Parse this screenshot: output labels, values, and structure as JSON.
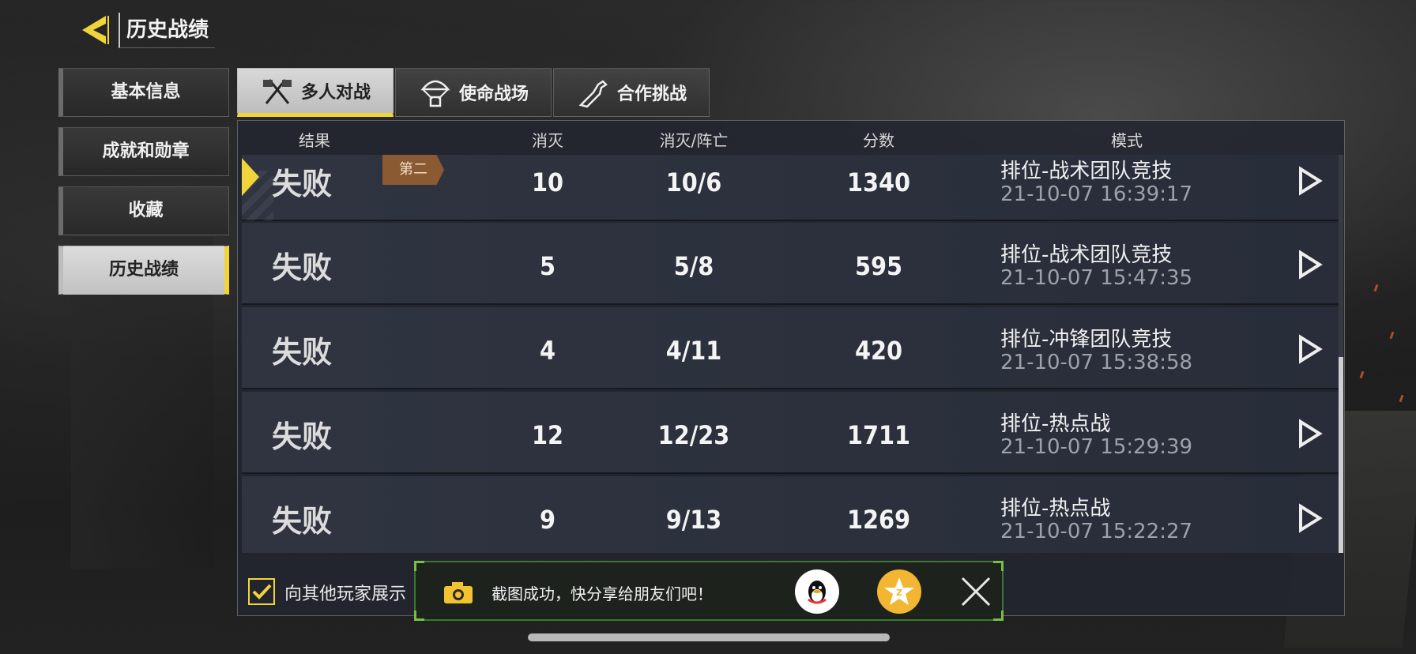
{
  "header": {
    "title": "历史战绩"
  },
  "sidebar": {
    "items": [
      {
        "label": "基本信息",
        "active": false
      },
      {
        "label": "成就和勋章",
        "active": false
      },
      {
        "label": "收藏",
        "active": false
      },
      {
        "label": "历史战绩",
        "active": true
      }
    ]
  },
  "tabs": [
    {
      "label": "多人对战",
      "icon": "crossed-flags-icon",
      "active": true
    },
    {
      "label": "使命战场",
      "icon": "parachute-crate-icon",
      "active": false
    },
    {
      "label": "合作挑战",
      "icon": "zombie-arm-icon",
      "active": false
    }
  ],
  "table": {
    "columns": [
      "结果",
      "消灭",
      "消灭/阵亡",
      "分数",
      "模式"
    ],
    "rows": [
      {
        "result": "失败",
        "kills": "10",
        "kd": "10/6",
        "score": "1340",
        "mode": "排位-战术团队竞技",
        "time": "21-10-07 16:39:17",
        "badge": "第二",
        "selected": true
      },
      {
        "result": "失败",
        "kills": "5",
        "kd": "5/8",
        "score": "595",
        "mode": "排位-战术团队竞技",
        "time": "21-10-07 15:47:35"
      },
      {
        "result": "失败",
        "kills": "4",
        "kd": "4/11",
        "score": "420",
        "mode": "排位-冲锋团队竞技",
        "time": "21-10-07 15:38:58"
      },
      {
        "result": "失败",
        "kills": "12",
        "kd": "12/23",
        "score": "1711",
        "mode": "排位-热点战",
        "time": "21-10-07 15:29:39"
      },
      {
        "result": "失败",
        "kills": "9",
        "kd": "9/13",
        "score": "1269",
        "mode": "排位-热点战",
        "time": "21-10-07 15:22:27"
      }
    ]
  },
  "show_to_others": {
    "label": "向其他玩家展示",
    "checked": true
  },
  "toast": {
    "message": "截图成功，快分享给朋友们吧！",
    "camera_icon": "camera-icon",
    "share_targets": [
      "qq-icon",
      "qzone-icon"
    ]
  },
  "colors": {
    "accent": "#f1d43a",
    "badge": "#8a5a32",
    "toast_border": "#3b7a2e"
  }
}
